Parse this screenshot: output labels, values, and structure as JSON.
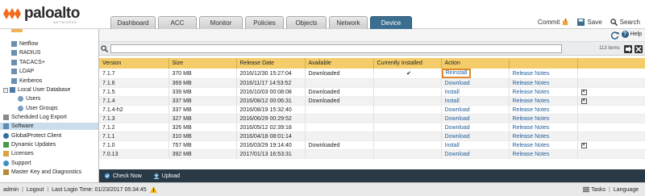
{
  "brand": {
    "name": "paloalto",
    "tagline": "NETWORKS"
  },
  "tabs": [
    {
      "label": "Dashboard"
    },
    {
      "label": "ACC"
    },
    {
      "label": "Monitor"
    },
    {
      "label": "Policies"
    },
    {
      "label": "Objects"
    },
    {
      "label": "Network"
    },
    {
      "label": "Device"
    }
  ],
  "active_tab": "Device",
  "header_actions": {
    "commit": "Commit",
    "save": "Save",
    "search": "Search"
  },
  "help_label": "Help",
  "sidebar": {
    "items": [
      {
        "label": "Netflow"
      },
      {
        "label": "RADIUS"
      },
      {
        "label": "TACACS+"
      },
      {
        "label": "LDAP"
      },
      {
        "label": "Kerberos"
      },
      {
        "label": "Local User Database"
      },
      {
        "label": "Users"
      },
      {
        "label": "User Groups"
      },
      {
        "label": "Scheduled Log Export"
      },
      {
        "label": "Software"
      },
      {
        "label": "GlobalProtect Client"
      },
      {
        "label": "Dynamic Updates"
      },
      {
        "label": "Licenses"
      },
      {
        "label": "Support"
      },
      {
        "label": "Master Key and Diagnostics"
      }
    ],
    "tree_toggle": "−",
    "selected": "Software"
  },
  "filter": {
    "placeholder": "",
    "count": "113 items"
  },
  "table": {
    "headers": [
      "Version",
      "Size",
      "Release Date",
      "Available",
      "Currently Installed",
      "Action",
      "",
      ""
    ],
    "rows": [
      {
        "version": "7.1.7",
        "size": "370 MB",
        "date": "2016/12/30 15:27:04",
        "available": "Downloaded",
        "installed": "✔",
        "action": "Reinstall",
        "notes": "Release Notes",
        "x": ""
      },
      {
        "version": "7.1.6",
        "size": "369 MB",
        "date": "2016/11/17 14:53:52",
        "available": "",
        "installed": "",
        "action": "Download",
        "notes": "Release Notes",
        "x": ""
      },
      {
        "version": "7.1.5",
        "size": "339 MB",
        "date": "2016/10/03 00:08:08",
        "available": "Downloaded",
        "installed": "",
        "action": "Install",
        "notes": "Release Notes",
        "x": "✕"
      },
      {
        "version": "7.1.4",
        "size": "337 MB",
        "date": "2016/08/12 00:06:31",
        "available": "Downloaded",
        "installed": "",
        "action": "Install",
        "notes": "Release Notes",
        "x": "✕"
      },
      {
        "version": "7.1.4-h2",
        "size": "337 MB",
        "date": "2016/08/19 15:32:40",
        "available": "",
        "installed": "",
        "action": "Download",
        "notes": "Release Notes",
        "x": ""
      },
      {
        "version": "7.1.3",
        "size": "327 MB",
        "date": "2016/06/29 00:29:52",
        "available": "",
        "installed": "",
        "action": "Download",
        "notes": "Release Notes",
        "x": ""
      },
      {
        "version": "7.1.2",
        "size": "326 MB",
        "date": "2016/05/12 02:39:18",
        "available": "",
        "installed": "",
        "action": "Download",
        "notes": "Release Notes",
        "x": ""
      },
      {
        "version": "7.1.1",
        "size": "310 MB",
        "date": "2016/04/18 08:01:14",
        "available": "",
        "installed": "",
        "action": "Download",
        "notes": "Release Notes",
        "x": ""
      },
      {
        "version": "7.1.0",
        "size": "757 MB",
        "date": "2016/03/29 19:14:40",
        "available": "Downloaded",
        "installed": "",
        "action": "Install",
        "notes": "Release Notes",
        "x": "✕"
      },
      {
        "version": "7.0.13",
        "size": "392 MB",
        "date": "2017/01/13 16:53:31",
        "available": "",
        "installed": "",
        "action": "Download",
        "notes": "Release Notes",
        "x": ""
      }
    ]
  },
  "footer_actions": {
    "check_now": "Check Now",
    "upload": "Upload"
  },
  "statusbar": {
    "user": "admin",
    "logout": "Logout",
    "last_login": "Last Login Time: 01/23/2017 05:34:45",
    "tasks": "Tasks",
    "language": "Language"
  },
  "colors": {
    "active_tab": "#3b6e8f",
    "table_header": "#f4cd6a",
    "link": "#1f5f9c",
    "highlight_box": "#e08a2a",
    "footer_bar": "#2a3946"
  }
}
